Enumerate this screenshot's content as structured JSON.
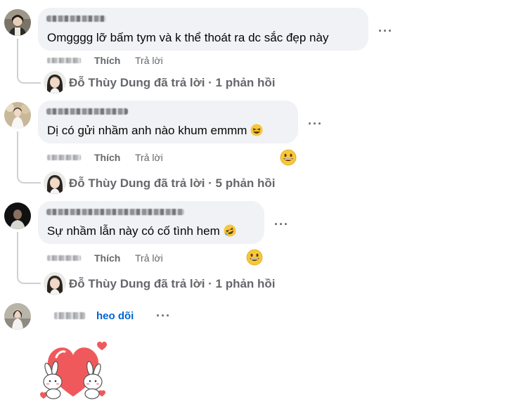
{
  "comments": [
    {
      "text": "Omgggg lỡ bấm tym và k thể thoát ra dc sắc đẹp này",
      "like_label": "Thích",
      "reply_label": "Trả lời",
      "reply_summary": "Đỗ Thùy Dung đã trả lời · 1 phản hồi"
    },
    {
      "text": "Dị có gửi nhầm anh nào khum emmm",
      "like_label": "Thích",
      "reply_label": "Trả lời",
      "reply_summary": "Đỗ Thùy Dung đã trả lời · 5 phản hồi"
    },
    {
      "text": "Sự nhầm lẫn này có cố tình hem",
      "like_label": "Thích",
      "reply_label": "Trả lời",
      "reply_summary": "Đỗ Thùy Dung đã trả lời · 1 phản hồi"
    }
  ],
  "last_comment": {
    "follow_label": "heo dõi"
  },
  "more_label": "···",
  "colors": {
    "bubble": "#f0f2f5",
    "secondary_text": "#65676b",
    "link_blue": "#0064d1",
    "thread_line": "#ced0d4"
  }
}
